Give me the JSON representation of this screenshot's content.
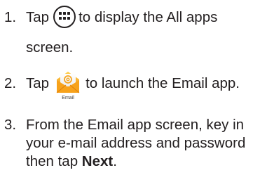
{
  "steps": [
    {
      "number": "1.",
      "before_icon": "Tap",
      "icon": "all-apps-icon",
      "after_icon": "to display the All apps",
      "continuation": "screen."
    },
    {
      "number": "2.",
      "before_icon": "Tap",
      "icon": "email-app-icon",
      "icon_caption": "Email",
      "after_icon": "to launch the Email app."
    },
    {
      "number": "3.",
      "line1": "From the Email app screen, key in",
      "line2": "your e-mail address and password",
      "line3_prefix": "then tap",
      "line3_bold": "Next",
      "line3_suffix": "."
    }
  ],
  "colors": {
    "text": "#231f20",
    "email_icon_orange": "#f5a623",
    "email_icon_envelope": "#ffd36b"
  }
}
